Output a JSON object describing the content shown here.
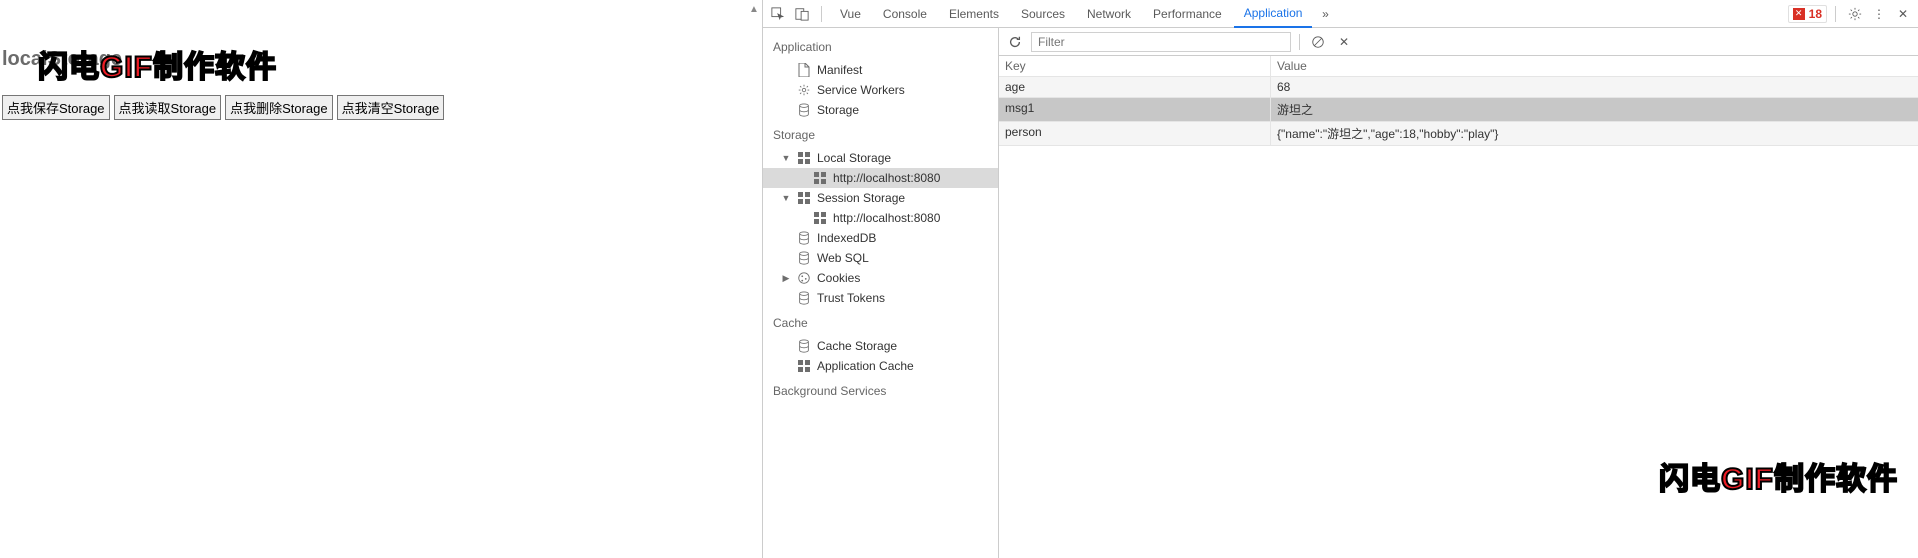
{
  "page": {
    "title": "localStorage",
    "buttons": [
      "点我保存Storage",
      "点我读取Storage",
      "点我删除Storage",
      "点我清空Storage"
    ]
  },
  "watermark": {
    "red": "闪电GIF",
    "black": "制作软件"
  },
  "devtools": {
    "tabs": [
      "Vue",
      "Console",
      "Elements",
      "Sources",
      "Network",
      "Performance",
      "Application"
    ],
    "activeTab": "Application",
    "errorCount": "18",
    "sidebar": {
      "groups": [
        {
          "title": "Application",
          "items": [
            {
              "icon": "file",
              "label": "Manifest"
            },
            {
              "icon": "gear",
              "label": "Service Workers"
            },
            {
              "icon": "db",
              "label": "Storage"
            }
          ]
        },
        {
          "title": "Storage",
          "items": [
            {
              "icon": "grid",
              "label": "Local Storage",
              "arrow": "down",
              "children": [
                {
                  "icon": "grid",
                  "label": "http://localhost:8080",
                  "selected": true
                }
              ]
            },
            {
              "icon": "grid",
              "label": "Session Storage",
              "arrow": "down",
              "children": [
                {
                  "icon": "grid",
                  "label": "http://localhost:8080"
                }
              ]
            },
            {
              "icon": "db",
              "label": "IndexedDB"
            },
            {
              "icon": "db",
              "label": "Web SQL"
            },
            {
              "icon": "cookie",
              "label": "Cookies",
              "arrow": "right"
            },
            {
              "icon": "db",
              "label": "Trust Tokens"
            }
          ]
        },
        {
          "title": "Cache",
          "items": [
            {
              "icon": "db",
              "label": "Cache Storage"
            },
            {
              "icon": "grid",
              "label": "Application Cache"
            }
          ]
        },
        {
          "title": "Background Services",
          "items": []
        }
      ]
    },
    "toolbar": {
      "filterPlaceholder": "Filter"
    },
    "table": {
      "headers": {
        "key": "Key",
        "value": "Value"
      },
      "rows": [
        {
          "key": "age",
          "value": "68"
        },
        {
          "key": "msg1",
          "value": "游坦之",
          "selected": true
        },
        {
          "key": "person",
          "value": "{\"name\":\"游坦之\",\"age\":18,\"hobby\":\"play\"}"
        }
      ]
    }
  }
}
